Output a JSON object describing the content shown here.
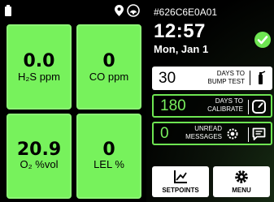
{
  "status": {
    "icons": [
      "battery-icon",
      "location-pin-icon",
      "wireless-signal-icon"
    ]
  },
  "tiles": [
    {
      "value": "0.0",
      "label": "H₂S ppm"
    },
    {
      "value": "0",
      "label": "CO ppm"
    },
    {
      "value": "20.9",
      "label": "O₂ %vol"
    },
    {
      "value": "0",
      "label": "LEL %"
    }
  ],
  "info": {
    "serial": "#626C6E0A01",
    "time": "12:57",
    "date": "Mon, Jan 1",
    "status_icon": "checkmark-circle-icon"
  },
  "cards": {
    "bump": {
      "value": "30",
      "caption_line1": "DAYS TO",
      "caption_line2": "BUMP TEST",
      "icon": "gas-bottle-icon"
    },
    "calibrate": {
      "value": "180",
      "caption_line1": "DAYS TO",
      "caption_line2": "CALIBRATE",
      "icon": "gauge-icon"
    },
    "messages": {
      "value": "0",
      "caption_line1": "UNREAD",
      "caption_line2": "MESSAGES",
      "icon": "message-icon",
      "extra_icon": "gear-icon"
    }
  },
  "nav": {
    "setpoints_label": "SETPOINTS",
    "menu_label": "MENU",
    "setpoints_icon": "chart-icon",
    "menu_icon": "gear-icon"
  },
  "colors": {
    "tile_green": "#77f25c",
    "accent_green": "#6ee552",
    "background": "#000000"
  }
}
